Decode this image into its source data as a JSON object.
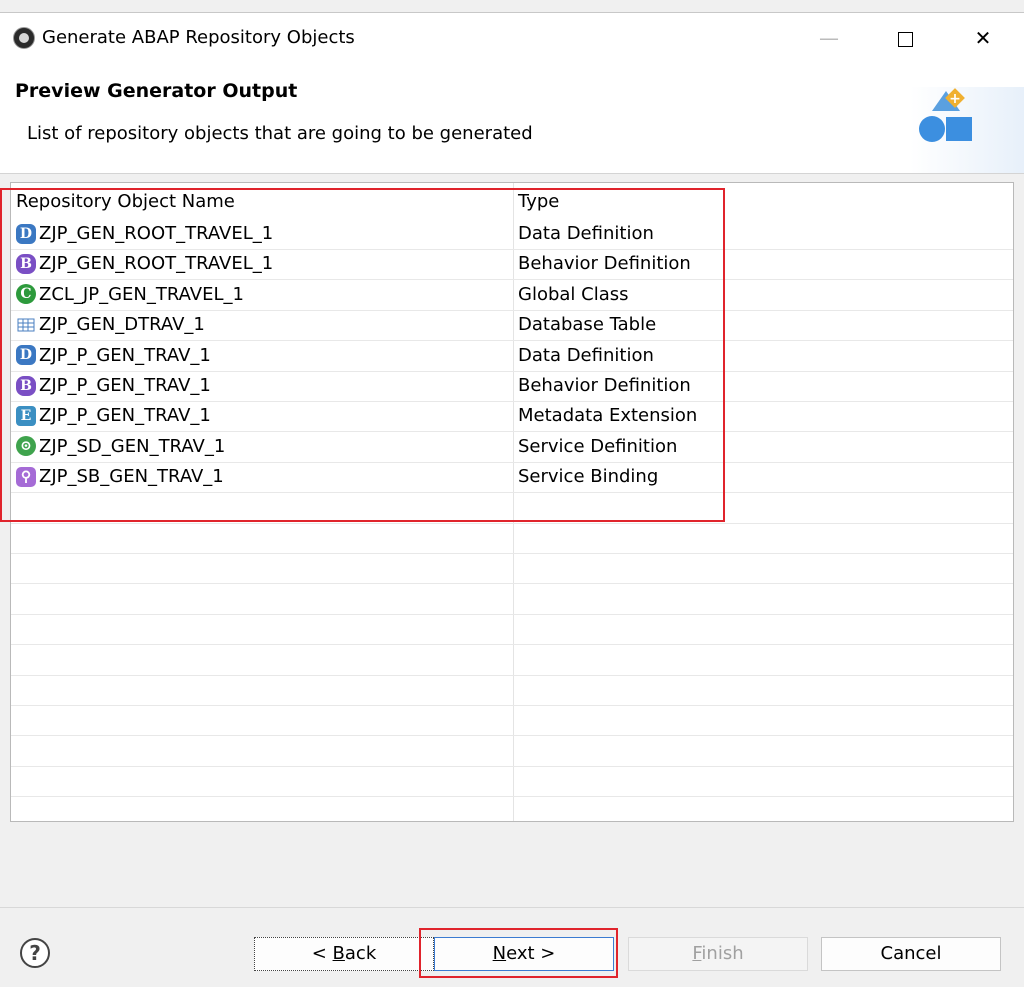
{
  "window": {
    "title": "Generate ABAP Repository Objects",
    "minimize_label": "—",
    "close_label": "✕"
  },
  "header": {
    "title": "Preview Generator Output",
    "description": "List of repository objects that are going to be generated"
  },
  "table": {
    "columns": [
      "Repository Object Name",
      "Type"
    ],
    "rows": [
      {
        "icon": "data-definition-icon",
        "glyph": "D",
        "name": "ZJP_GEN_ROOT_TRAVEL_1",
        "type": "Data Definition"
      },
      {
        "icon": "behavior-definition-icon",
        "glyph": "B",
        "name": "ZJP_GEN_ROOT_TRAVEL_1",
        "type": "Behavior Definition"
      },
      {
        "icon": "global-class-icon",
        "glyph": "C",
        "name": "ZCL_JP_GEN_TRAVEL_1",
        "type": "Global Class"
      },
      {
        "icon": "database-table-icon",
        "glyph": "T",
        "name": "ZJP_GEN_DTRAV_1",
        "type": "Database Table"
      },
      {
        "icon": "data-definition-icon",
        "glyph": "D",
        "name": "ZJP_P_GEN_TRAV_1",
        "type": "Data Definition"
      },
      {
        "icon": "behavior-definition-icon",
        "glyph": "B",
        "name": "ZJP_P_GEN_TRAV_1",
        "type": "Behavior Definition"
      },
      {
        "icon": "metadata-extension-icon",
        "glyph": "E",
        "name": "ZJP_P_GEN_TRAV_1",
        "type": "Metadata Extension"
      },
      {
        "icon": "service-definition-icon",
        "glyph": "S",
        "name": "ZJP_SD_GEN_TRAV_1",
        "type": "Service Definition"
      },
      {
        "icon": "service-binding-icon",
        "glyph": "L",
        "name": "ZJP_SB_GEN_TRAV_1",
        "type": "Service Binding"
      }
    ]
  },
  "buttons": {
    "help": "?",
    "back_prefix": "< ",
    "back_mnemonic": "B",
    "back_rest": "ack",
    "next_mnemonic": "N",
    "next_rest": "ext >",
    "finish_mnemonic": "F",
    "finish_rest": "inish",
    "cancel": "Cancel"
  },
  "colors": {
    "highlight": "#e0242c",
    "accent": "#3b7bd1"
  }
}
